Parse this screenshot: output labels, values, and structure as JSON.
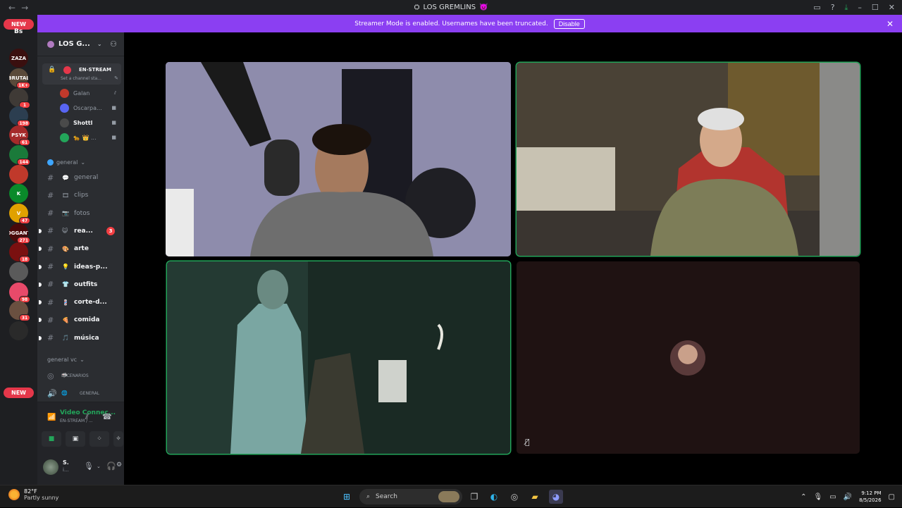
{
  "titlebar": {
    "title": "LOS GREMLINS",
    "title_icon": "server-icon",
    "title_emoji": "👿"
  },
  "banner": {
    "text": "Streamer Mode is enabled. Usernames have been truncated.",
    "button": "Disable"
  },
  "rail": {
    "new_top": "NEW",
    "bs_label": "Bs",
    "new_bottom": "NEW",
    "servers": [
      {
        "label": "ZAZA",
        "color": "#3a0f0f",
        "badge": ""
      },
      {
        "label": "BRUTAL",
        "color": "#5a4a3a",
        "badge": "1K+"
      },
      {
        "label": "",
        "color": "#3f3a36",
        "badge": "1"
      },
      {
        "label": "",
        "color": "#2c3e50",
        "badge": "198"
      },
      {
        "label": "PSYK",
        "color": "#a52a2a",
        "badge": "61"
      },
      {
        "label": "",
        "color": "#1a7a3a",
        "badge": "144"
      },
      {
        "label": "",
        "color": "#c0392b",
        "badge": ""
      },
      {
        "label": "K",
        "color": "#0a8a2a",
        "badge": ""
      },
      {
        "label": "V",
        "color": "#e0a100",
        "badge": "47"
      },
      {
        "label": "FOGGANTE",
        "color": "#4a0a0a",
        "badge": "271"
      },
      {
        "label": "",
        "color": "#7a1010",
        "badge": "18"
      },
      {
        "label": "",
        "color": "#5a5a5a",
        "badge": ""
      },
      {
        "label": "",
        "color": "#e84a6a",
        "badge": "98"
      },
      {
        "label": "",
        "color": "#6a5040",
        "badge": "31"
      },
      {
        "label": "",
        "color": "#2a2a2a",
        "badge": ""
      }
    ]
  },
  "sidebar": {
    "server_name": "LOS G...",
    "voice_channel": {
      "name": "EN-STREAM",
      "status": "Set a channel sta...",
      "users": [
        {
          "name": "Galan",
          "color": "#c0392b",
          "icon": "deafened-icon"
        },
        {
          "name": "Oscarpa...",
          "color": "#5865f2",
          "icon": "video-icon"
        },
        {
          "name": "Shottl",
          "color": "#4a4a4a",
          "icon": "video-icon"
        },
        {
          "name": "🐆 👑 ...",
          "color": "#23a55a",
          "icon": "video-icon"
        }
      ]
    },
    "category_general": "general",
    "channels": [
      {
        "emoji": "💬",
        "name": "general",
        "unread": false,
        "count": ""
      },
      {
        "emoji": "🎞",
        "name": "clips",
        "unread": false,
        "count": ""
      },
      {
        "emoji": "📷",
        "name": "fotos",
        "unread": false,
        "count": ""
      },
      {
        "emoji": "😺",
        "name": "rea...",
        "unread": true,
        "count": "3"
      },
      {
        "emoji": "🎨",
        "name": "arte",
        "unread": true,
        "count": ""
      },
      {
        "emoji": "💡",
        "name": "ideas-p...",
        "unread": true,
        "count": ""
      },
      {
        "emoji": "👕",
        "name": "outfits",
        "unread": true,
        "count": ""
      },
      {
        "emoji": "💈",
        "name": "corte-d...",
        "unread": true,
        "count": ""
      },
      {
        "emoji": "🍕",
        "name": "comida",
        "unread": true,
        "count": ""
      },
      {
        "emoji": "🎵",
        "name": "música",
        "unread": true,
        "count": ""
      }
    ],
    "category_vc": "general vc",
    "vc_channels": [
      {
        "name": "ESCENARIOS",
        "icon": "stage-icon"
      },
      {
        "name": "GENERAL",
        "icon": "speaker-icon"
      }
    ],
    "voice_panel": {
      "status": "Video Connec...",
      "sub": "EN-STREAM / ..."
    },
    "user_panel": {
      "name": "S.",
      "status": "i..."
    }
  },
  "taskbar": {
    "temp": "82°F",
    "weather": "Partly sunny",
    "search": "Search",
    "time": "9:12 PM",
    "date": "8/5/2026"
  }
}
